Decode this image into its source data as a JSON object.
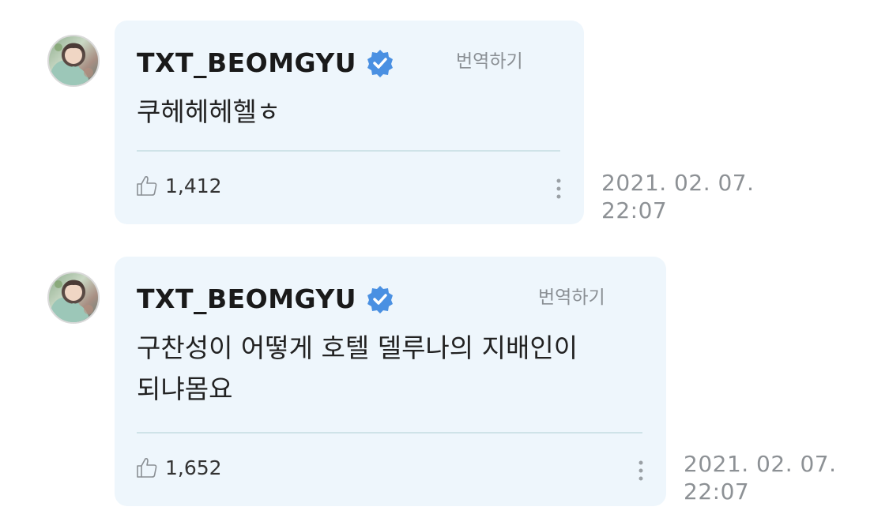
{
  "posts": [
    {
      "author": "TXT_BEOMGYU",
      "translate_label": "번역하기",
      "message_lines": [
        "쿠헤헤헤헬ㅎ"
      ],
      "like_count": "1,412",
      "timestamp_date": "2021. 02. 07.",
      "timestamp_time": "22:07"
    },
    {
      "author": "TXT_BEOMGYU",
      "translate_label": "번역하기",
      "message_lines": [
        "구찬성이 어떻게 호텔 델루나의 지배인이",
        "되냐몸요"
      ],
      "like_count": "1,652",
      "timestamp_date": "2021. 02. 07.",
      "timestamp_time": "22:07"
    }
  ],
  "colors": {
    "bubble": "#eef6fc",
    "verified": "#4a90e2",
    "divider": "#cfe3e8",
    "muted_text": "#8d9195"
  },
  "icons": {
    "verified": "verified-badge-icon",
    "like": "thumbs-up-icon",
    "more": "more-vertical-icon"
  }
}
